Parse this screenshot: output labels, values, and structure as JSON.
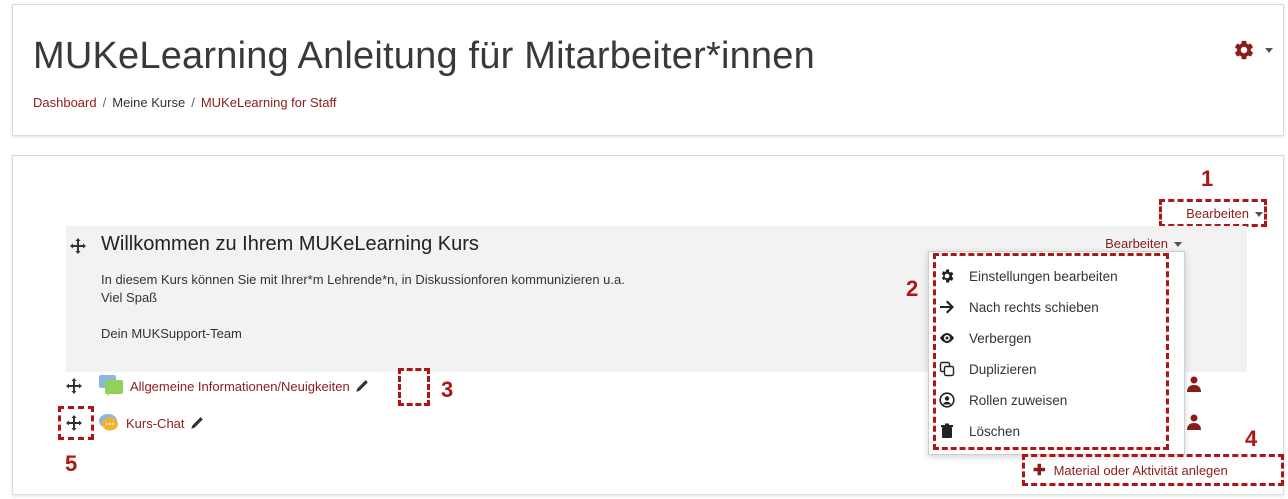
{
  "header": {
    "title": "MUKeLearning Anleitung für Mitarbeiter*innen",
    "breadcrumb": [
      "Dashboard",
      "Meine Kurse",
      "MUKeLearning for Staff"
    ],
    "breadcrumb_sep": "/"
  },
  "content": {
    "edit_label": "Bearbeiten",
    "section": {
      "title": "Willkommen zu Ihrem MUKeLearning Kurs",
      "text_line1": "In diesem Kurs können Sie mit Ihrer*m Lehrende*n, in Diskussionforen kommunizieren u.a.",
      "text_line2": "Viel Spaß",
      "text_line3": "Dein MUKSupport-Team",
      "edit_label": "Bearbeiten"
    },
    "activities": [
      {
        "label": "Allgemeine Informationen/Neuigkeiten",
        "icon": "forum-icon"
      },
      {
        "label": "Kurs-Chat",
        "icon": "chat-icon"
      }
    ],
    "dropdown_items": [
      {
        "label": "Einstellungen bearbeiten",
        "icon": "gear-icon"
      },
      {
        "label": "Nach rechts schieben",
        "icon": "arrow-right-icon"
      },
      {
        "label": "Verbergen",
        "icon": "eye-icon"
      },
      {
        "label": "Duplizieren",
        "icon": "duplicate-icon"
      },
      {
        "label": "Rollen zuweisen",
        "icon": "user-circle-icon"
      },
      {
        "label": "Löschen",
        "icon": "trash-icon"
      }
    ],
    "add_activity_label": "Material oder Aktivität anlegen",
    "annotations": [
      "1",
      "2",
      "3",
      "4",
      "5"
    ]
  },
  "colors": {
    "accent": "#8b1c1c",
    "annotation": "#b01515",
    "section_bg": "#f2f2f2"
  }
}
